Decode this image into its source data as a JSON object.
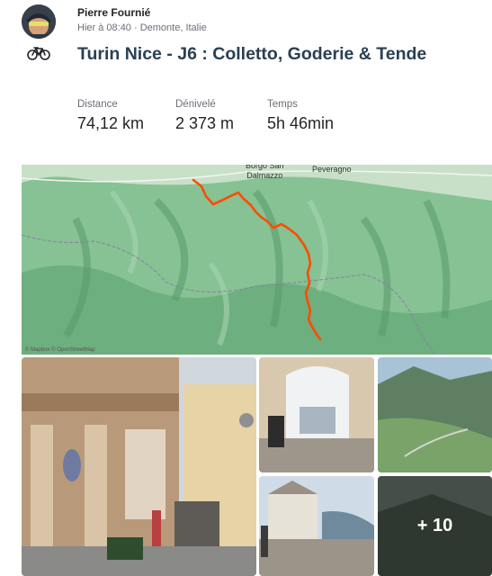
{
  "activity": {
    "author": "Pierre Fournié",
    "meta": "Hier à 08:40 · Demonte, Italie",
    "sport_icon": "bike-icon",
    "title": "Turin Nice - J6 : Colletto, Goderie & Tende"
  },
  "stats": [
    {
      "label": "Distance",
      "value": "74,12 km"
    },
    {
      "label": "Dénivelé",
      "value": "2 373 m"
    },
    {
      "label": "Temps",
      "value": "5h 46min"
    }
  ],
  "map": {
    "place_1": "Borgo San\nDalmazzo",
    "place_2": "Peveragno",
    "attribution": "© Mapbox © OpenStreetMap",
    "route_color": "#fc4c02"
  },
  "photos": {
    "more_label": "+ 10"
  },
  "colors": {
    "title": "#2a4052",
    "accent": "#fc4c02"
  }
}
